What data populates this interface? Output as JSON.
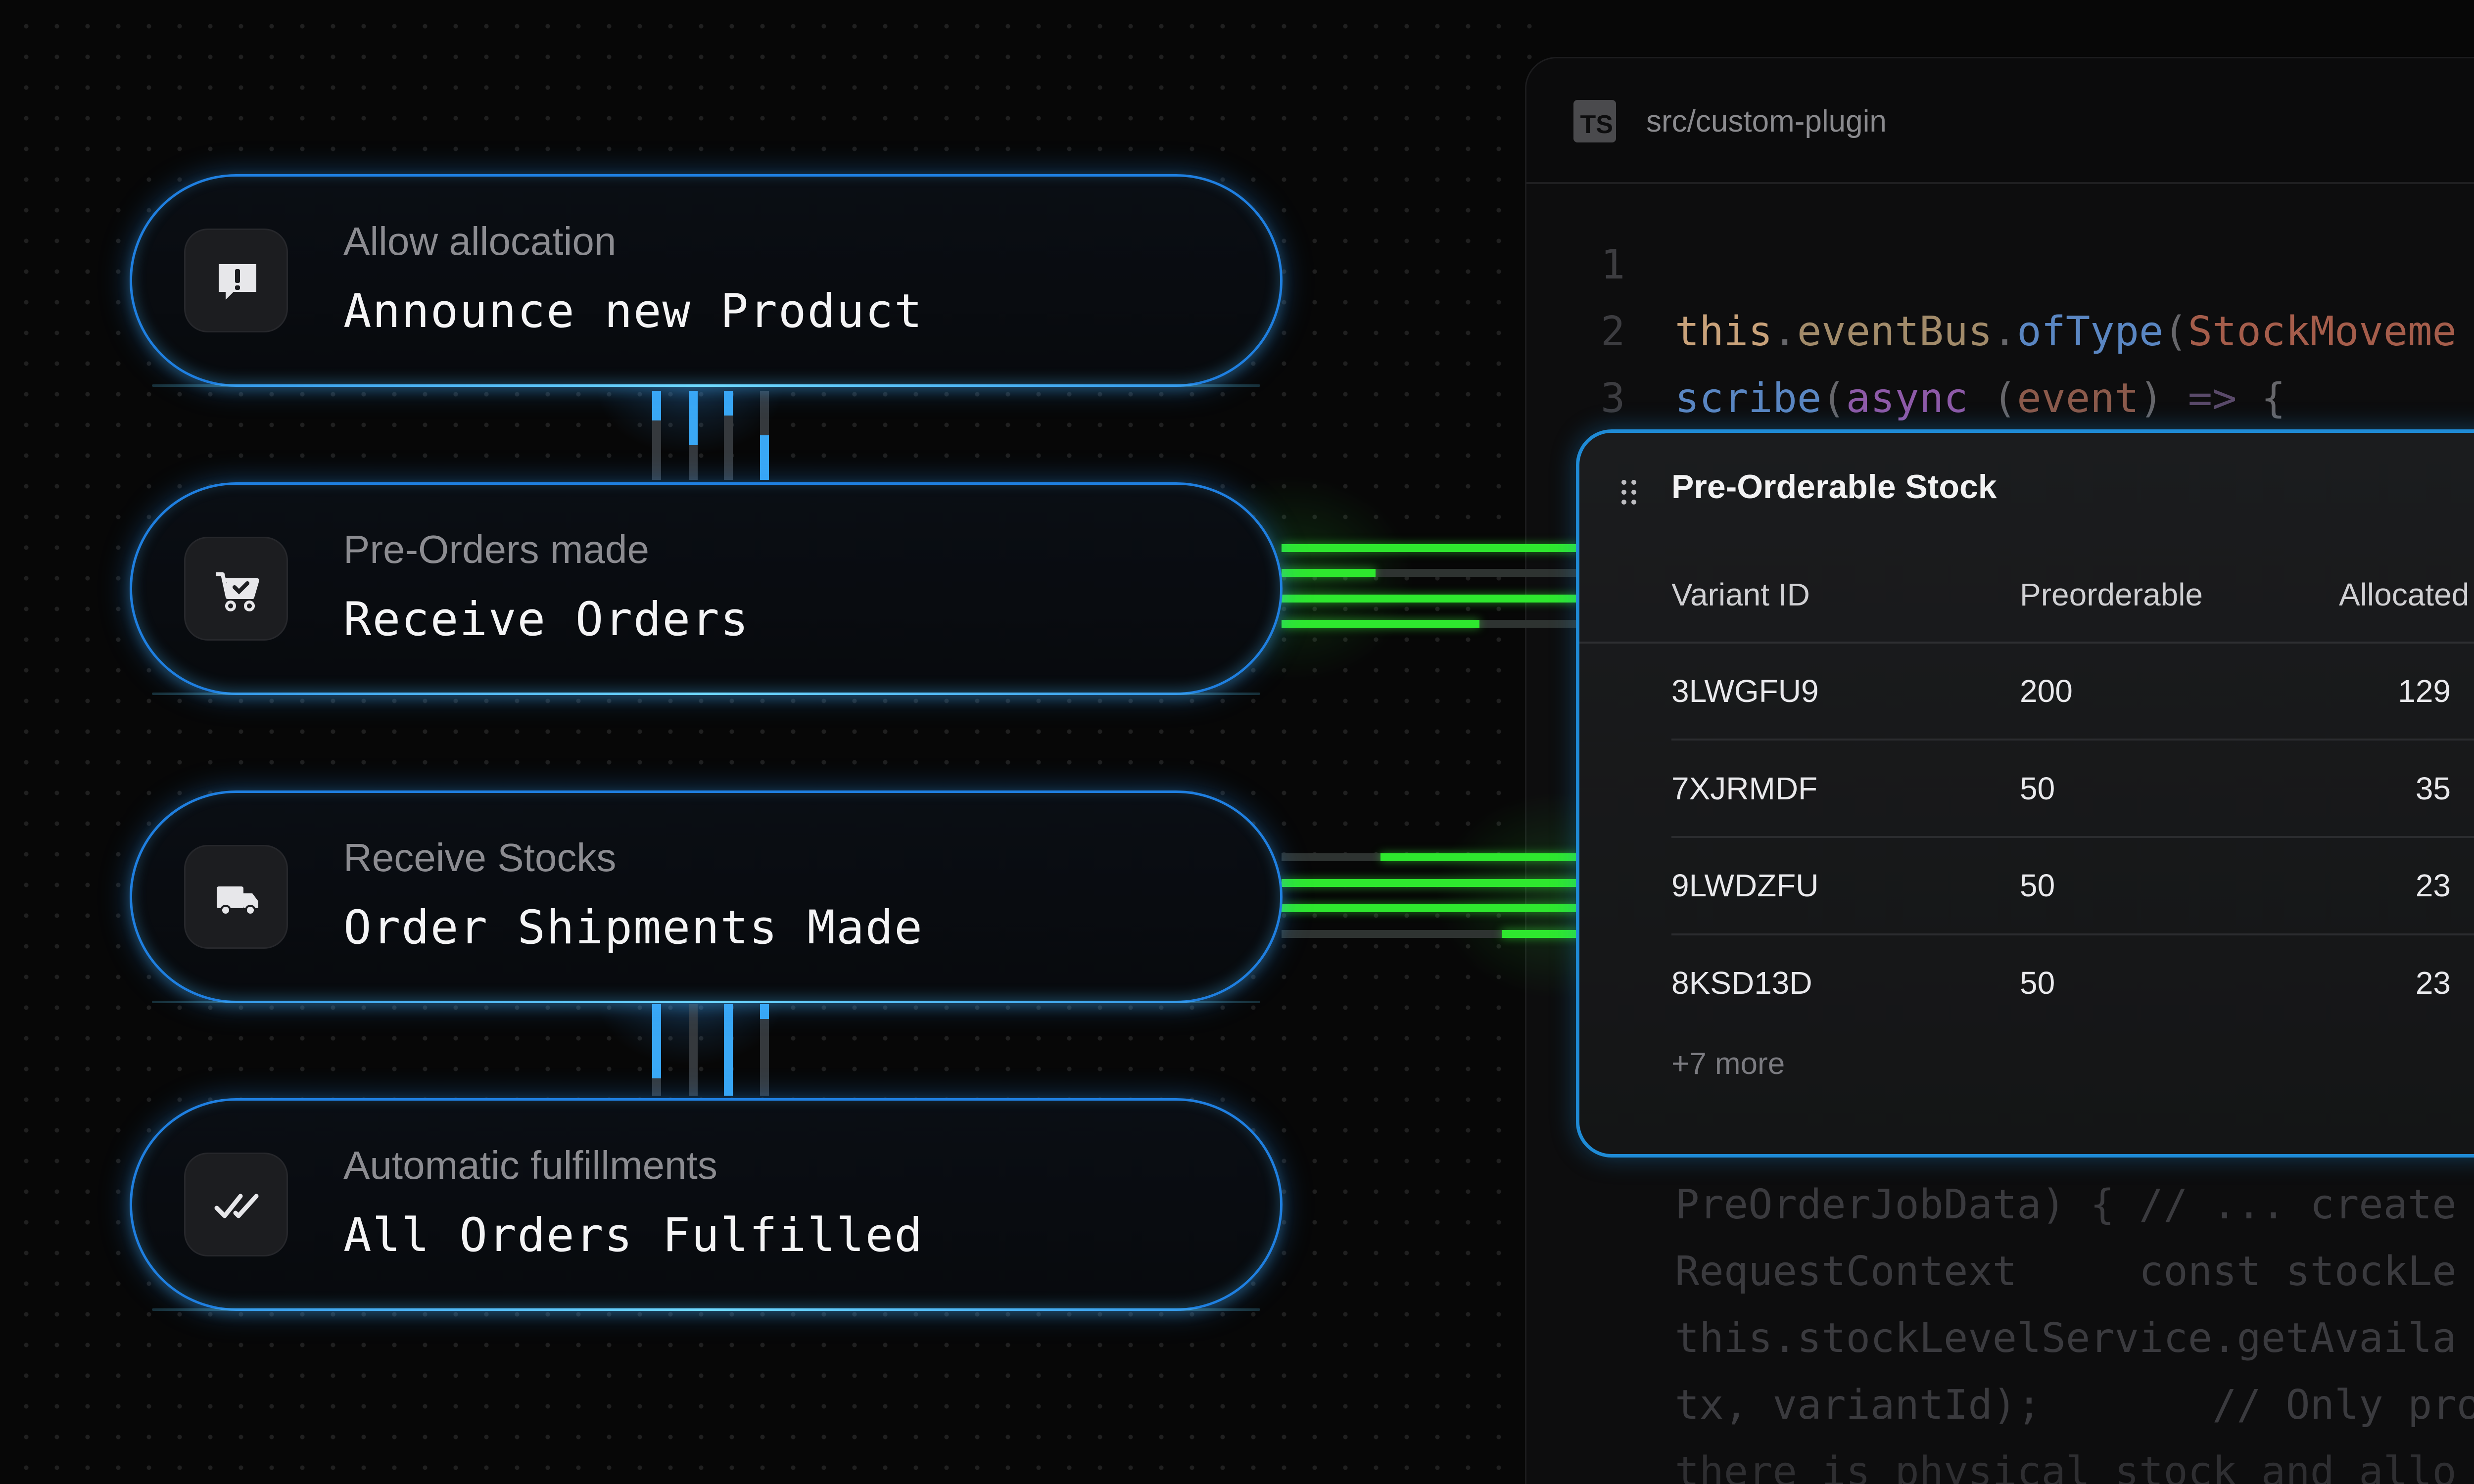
{
  "editor": {
    "file_badge": "TS",
    "file_path": "src/custom-plugin",
    "lines": [
      {
        "n": "1",
        "text": ""
      },
      {
        "n": "2",
        "tokens": [
          "this",
          ".",
          "eventBus",
          ".",
          "ofType",
          "(",
          "StockMoveme"
        ]
      },
      {
        "n": "3",
        "tokens": [
          "scribe",
          "(",
          "async",
          " (",
          "event",
          ") ",
          "=>",
          " {"
        ]
      }
    ],
    "lower_lines": [
      "PreOrderJobData) { // ... create",
      "RequestContext     const stockLe",
      "this.stockLevelService.getAvaila",
      "tx, variantId);       // Only pro",
      "there is physical stock and allo"
    ]
  },
  "flow": {
    "cards": [
      {
        "label": "Allow allocation",
        "title": "Announce new Product",
        "icon": "alert-message-icon"
      },
      {
        "label": "Pre-Orders made",
        "title": "Receive Orders",
        "icon": "cart-check-icon"
      },
      {
        "label": "Receive Stocks",
        "title": "Order Shipments Made",
        "icon": "truck-icon"
      },
      {
        "label": "Automatic fulfillments",
        "title": "All Orders Fulfilled",
        "icon": "double-check-icon"
      }
    ]
  },
  "popup": {
    "title": "Pre-Orderable Stock",
    "columns": [
      "Variant ID",
      "Preorderable",
      "Allocated"
    ],
    "rows": [
      {
        "variant": "3LWGFU9",
        "preorderable": "200",
        "allocated": "129"
      },
      {
        "variant": "7XJRMDF",
        "preorderable": "50",
        "allocated": "35"
      },
      {
        "variant": "9LWDZFU",
        "preorderable": "50",
        "allocated": "23"
      },
      {
        "variant": "8KSD13D",
        "preorderable": "50",
        "allocated": "23"
      }
    ],
    "more": "+7 more"
  },
  "colors": {
    "card_border": "#1f7fe0",
    "popup_border": "#1f8bd6",
    "green_connector": "#2ee82e",
    "blue_connector": "#3aa0ee"
  }
}
